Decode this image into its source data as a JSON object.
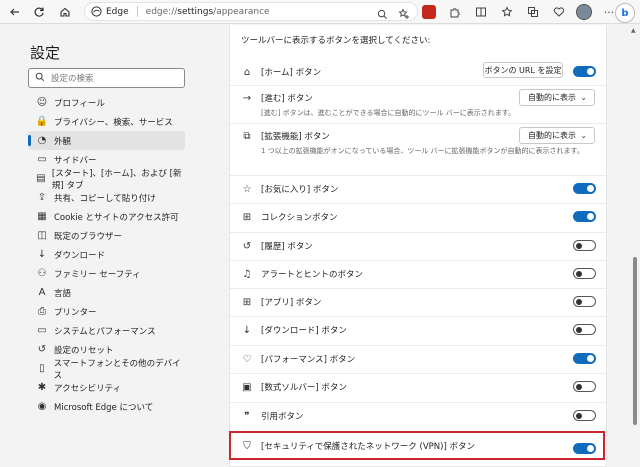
{
  "browser": {
    "site_label": "Edge",
    "url_host": "edge://",
    "url_path_bold": "settings",
    "url_path_rest": "/appearance",
    "bing_label": "b"
  },
  "sidebar": {
    "title": "設定",
    "search_placeholder": "設定の検索",
    "items": [
      {
        "label": "プロフィール",
        "icon": "profile-icon",
        "glyph": "☺"
      },
      {
        "label": "プライバシー、検索、サービス",
        "icon": "lock-icon",
        "glyph": "🔒"
      },
      {
        "label": "外観",
        "icon": "palette-icon",
        "glyph": "◔",
        "active": true
      },
      {
        "label": "サイドバー",
        "icon": "sidebar-icon",
        "glyph": "▭"
      },
      {
        "label": "[スタート]、[ホーム]、および [新規] タブ",
        "icon": "home-tab-icon",
        "glyph": "▤"
      },
      {
        "label": "共有、コピーして貼り付け",
        "icon": "share-icon",
        "glyph": "⇪"
      },
      {
        "label": "Cookie とサイトのアクセス許可",
        "icon": "cookie-icon",
        "glyph": "▦"
      },
      {
        "label": "既定のブラウザー",
        "icon": "browser-icon",
        "glyph": "◫"
      },
      {
        "label": "ダウンロード",
        "icon": "download-icon",
        "glyph": "↓"
      },
      {
        "label": "ファミリー セーフティ",
        "icon": "family-icon",
        "glyph": "⚇"
      },
      {
        "label": "言語",
        "icon": "language-icon",
        "glyph": "A"
      },
      {
        "label": "プリンター",
        "icon": "printer-icon",
        "glyph": "⎙"
      },
      {
        "label": "システムとパフォーマンス",
        "icon": "system-icon",
        "glyph": "▭"
      },
      {
        "label": "設定のリセット",
        "icon": "reset-icon",
        "glyph": "↺"
      },
      {
        "label": "スマートフォンとその他のデバイス",
        "icon": "phone-icon",
        "glyph": "▯"
      },
      {
        "label": "アクセシビリティ",
        "icon": "accessibility-icon",
        "glyph": "✱"
      },
      {
        "label": "Microsoft Edge について",
        "icon": "edge-logo-icon",
        "glyph": "◉"
      }
    ]
  },
  "main": {
    "section_title": "ツールバーに表示するボタンを選択してください:",
    "rows": [
      {
        "label": "[ホーム] ボタン",
        "icon": "home-icon",
        "glyph": "⌂",
        "control": "toggle",
        "on": true,
        "extra_button": "ボタンの URL を設定"
      },
      {
        "label": "[進む] ボタン",
        "icon": "forward-icon",
        "glyph": "→",
        "control": "select",
        "value": "自動的に表示",
        "desc": "[進む] ボタンは、進むことができる場合に自動的にツール バーに表示されます。"
      },
      {
        "label": "[拡張機能] ボタン",
        "icon": "extensions-icon",
        "glyph": "⧉",
        "control": "select",
        "value": "自動的に表示",
        "desc": "1 つ以上の拡張機能がオンになっている場合、ツール バーに拡張機能ボタンが自動的に表示されます。"
      },
      {
        "label": "[お気に入り] ボタン",
        "icon": "favorites-icon",
        "glyph": "☆",
        "control": "toggle",
        "on": true
      },
      {
        "label": "コレクションボタン",
        "icon": "collections-icon",
        "glyph": "⊞",
        "control": "toggle",
        "on": true
      },
      {
        "label": "[履歴] ボタン",
        "icon": "history-icon",
        "glyph": "↺",
        "control": "toggle",
        "on": false
      },
      {
        "label": "アラートとヒントのボタン",
        "icon": "bell-icon",
        "glyph": "♫",
        "control": "toggle",
        "on": false
      },
      {
        "label": "[アプリ] ボタン",
        "icon": "apps-icon",
        "glyph": "⊞",
        "control": "toggle",
        "on": false
      },
      {
        "label": "[ダウンロード] ボタン",
        "icon": "download-icon",
        "glyph": "↓",
        "control": "toggle",
        "on": false
      },
      {
        "label": "[パフォーマンス] ボタン",
        "icon": "performance-icon",
        "glyph": "♡",
        "control": "toggle",
        "on": true
      },
      {
        "label": "[数式ソルバー] ボタン",
        "icon": "math-solver-icon",
        "glyph": "▣",
        "control": "toggle",
        "on": false
      },
      {
        "label": "引用ボタン",
        "icon": "quote-icon",
        "glyph": "❞",
        "control": "toggle",
        "on": false
      },
      {
        "label": "[セキュリティで保護されたネットワーク (VPN)] ボタン",
        "icon": "shield-icon",
        "glyph": "⛉",
        "control": "toggle",
        "on": true
      }
    ]
  },
  "colors": {
    "accent": "#0f6cbd",
    "highlight": "#c9252d"
  }
}
